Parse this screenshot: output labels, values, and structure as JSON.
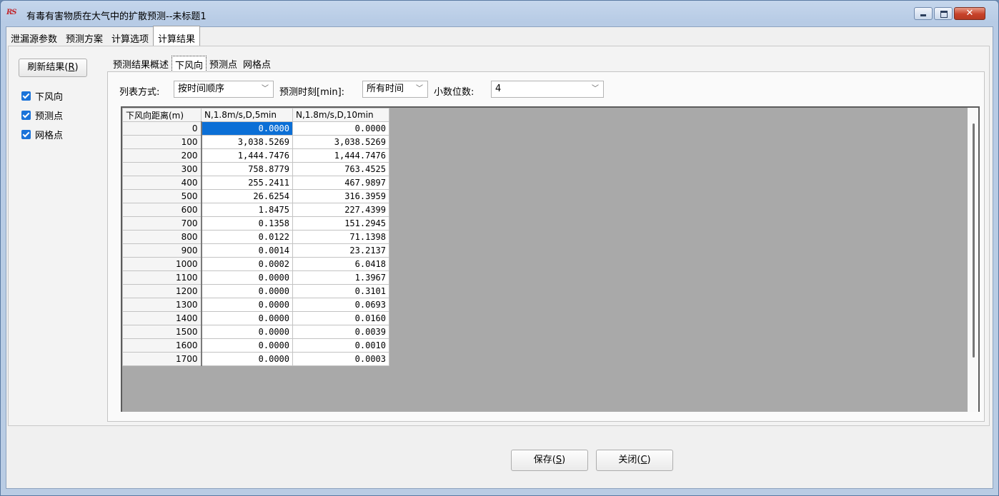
{
  "window": {
    "logo": "RS",
    "title": "有毒有害物质在大气中的扩散预测--未标题1",
    "close_glyph": "✕"
  },
  "top_tabs": [
    "泄漏源参数",
    "预测方案",
    "计算选项",
    "计算结果"
  ],
  "left_panel": {
    "refresh_label": "刷新结果(",
    "refresh_key": "R",
    "refresh_suffix": ")",
    "checkboxes": [
      {
        "label": "下风向",
        "checked": true
      },
      {
        "label": "预测点",
        "checked": true
      },
      {
        "label": "网格点",
        "checked": true
      }
    ]
  },
  "inner_tabs": [
    "预测结果概述",
    "下风向",
    "预测点",
    "网格点"
  ],
  "options": {
    "list_mode_label": "列表方式:",
    "list_mode_value": "按时间顺序",
    "time_label": "预测时刻[min]:",
    "time_value": "所有时间",
    "decimals_label": "小数位数:",
    "decimals_value": "4"
  },
  "grid": {
    "headers": [
      "下风向距离(m)",
      "N,1.8m/s,D,5min",
      "N,1.8m/s,D,10min"
    ],
    "rows": [
      [
        "0",
        "0.0000",
        "0.0000"
      ],
      [
        "100",
        "3,038.5269",
        "3,038.5269"
      ],
      [
        "200",
        "1,444.7476",
        "1,444.7476"
      ],
      [
        "300",
        "758.8779",
        "763.4525"
      ],
      [
        "400",
        "255.2411",
        "467.9897"
      ],
      [
        "500",
        "26.6254",
        "316.3959"
      ],
      [
        "600",
        "1.8475",
        "227.4399"
      ],
      [
        "700",
        "0.1358",
        "151.2945"
      ],
      [
        "800",
        "0.0122",
        "71.1398"
      ],
      [
        "900",
        "0.0014",
        "23.2137"
      ],
      [
        "1000",
        "0.0002",
        "6.0418"
      ],
      [
        "1100",
        "0.0000",
        "1.3967"
      ],
      [
        "1200",
        "0.0000",
        "0.3101"
      ],
      [
        "1300",
        "0.0000",
        "0.0693"
      ],
      [
        "1400",
        "0.0000",
        "0.0160"
      ],
      [
        "1500",
        "0.0000",
        "0.0039"
      ],
      [
        "1600",
        "0.0000",
        "0.0010"
      ],
      [
        "1700",
        "0.0000",
        "0.0003"
      ]
    ],
    "selected_row": 0,
    "selected_col": 1
  },
  "buttons": {
    "save_label": "保存(",
    "save_key": "S",
    "close_label": "关闭(",
    "close_key": "C",
    "suffix": ")"
  },
  "colors": {
    "selection": "#0b6fd6",
    "checkbox": "#1a73d9",
    "title_close": "#c7422a"
  }
}
